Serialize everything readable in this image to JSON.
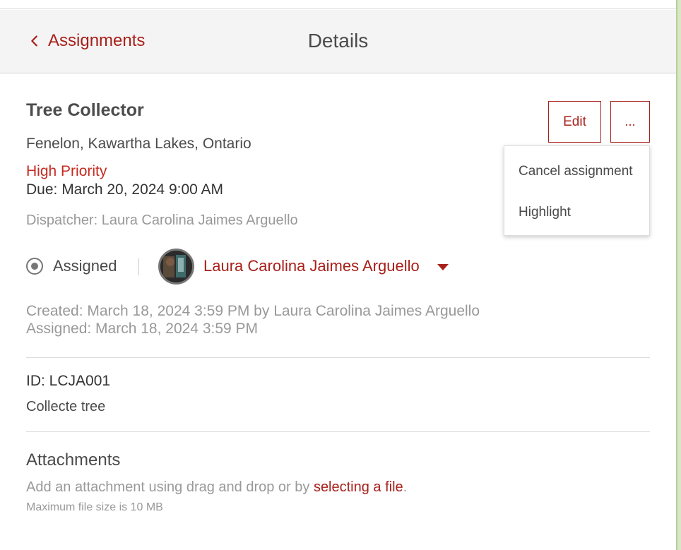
{
  "header": {
    "back_label": "Assignments",
    "title": "Details"
  },
  "assignment": {
    "title": "Tree Collector",
    "location": "Fenelon, Kawartha Lakes, Ontario",
    "priority": "High Priority",
    "due": "Due: March 20, 2024 9:00 AM",
    "dispatcher": "Dispatcher: Laura Carolina Jaimes Arguello",
    "status": "Assigned",
    "assignee": "Laura Carolina Jaimes Arguello",
    "created": "Created: March 18, 2024 3:59 PM by Laura Carolina Jaimes Arguello",
    "assigned": "Assigned: March 18, 2024 3:59 PM",
    "id": "ID: LCJA001",
    "description": "Collecte tree"
  },
  "actions": {
    "edit_label": "Edit",
    "more_label": "..."
  },
  "menu": {
    "items": [
      "Cancel assignment",
      "Highlight"
    ]
  },
  "attachments": {
    "title": "Attachments",
    "hint_prefix": "Add an attachment using drag and drop or by ",
    "hint_link": "selecting a file",
    "hint_suffix": ".",
    "max_size": "Maximum file size is 10 MB"
  },
  "colors": {
    "accent": "#a8201a",
    "priority": "#c52b20",
    "muted": "#999999"
  }
}
